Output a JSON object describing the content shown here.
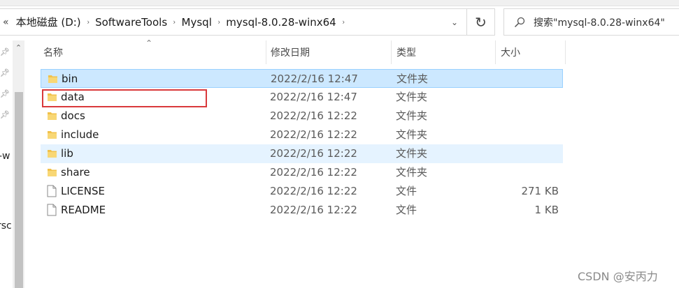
{
  "nav_back_label": "«",
  "breadcrumb": [
    "本地磁盘 (D:)",
    "SoftwareTools",
    "Mysql",
    "mysql-8.0.28-winx64"
  ],
  "breadcrumb_separator": "›",
  "address_dropdown": "⌄",
  "refresh_glyph": "↻",
  "search": {
    "placeholder": "搜索\"mysql-8.0.28-winx64\""
  },
  "left_pane_clipped_text": [
    "-w",
    "rsc"
  ],
  "columns": {
    "name": "名称",
    "date": "修改日期",
    "type": "类型",
    "size": "大小"
  },
  "files": [
    {
      "name": "bin",
      "date": "2022/2/16 12:47",
      "type": "文件夹",
      "size": "",
      "icon": "folder-icon",
      "state": "selected"
    },
    {
      "name": "data",
      "date": "2022/2/16 12:47",
      "type": "文件夹",
      "size": "",
      "icon": "folder-icon",
      "state": "annotated"
    },
    {
      "name": "docs",
      "date": "2022/2/16 12:22",
      "type": "文件夹",
      "size": "",
      "icon": "folder-icon",
      "state": ""
    },
    {
      "name": "include",
      "date": "2022/2/16 12:22",
      "type": "文件夹",
      "size": "",
      "icon": "folder-icon",
      "state": ""
    },
    {
      "name": "lib",
      "date": "2022/2/16 12:22",
      "type": "文件夹",
      "size": "",
      "icon": "folder-icon",
      "state": "hover"
    },
    {
      "name": "share",
      "date": "2022/2/16 12:22",
      "type": "文件夹",
      "size": "",
      "icon": "folder-icon",
      "state": ""
    },
    {
      "name": "LICENSE",
      "date": "2022/2/16 12:22",
      "type": "文件",
      "size": "271 KB",
      "icon": "file-icon",
      "state": ""
    },
    {
      "name": "README",
      "date": "2022/2/16 12:22",
      "type": "文件",
      "size": "1 KB",
      "icon": "file-icon",
      "state": ""
    }
  ],
  "colors": {
    "selected_bg": "#cce8ff",
    "hover_bg": "#e5f3ff",
    "annotation_border": "#d9393b",
    "folder": "#f1c14a"
  },
  "watermark": "CSDN @安丙力"
}
